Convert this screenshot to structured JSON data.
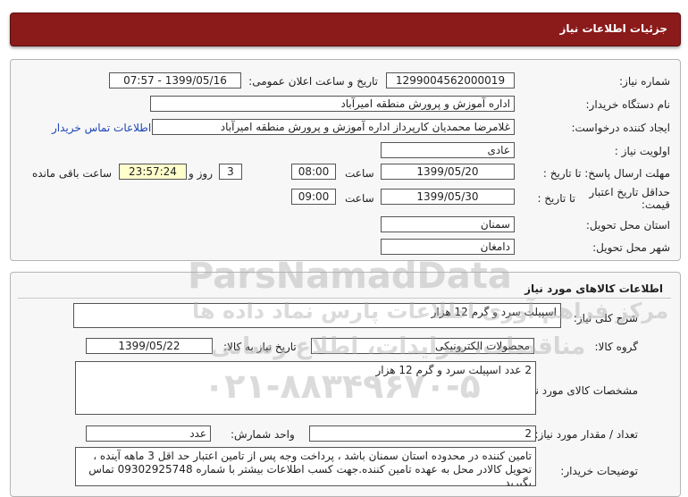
{
  "header": {
    "title": "جزئیات اطلاعات نیاز"
  },
  "watermark": {
    "brand": "ParsNamadData",
    "fa_line1": "مرکز فراهم آوری اطلاعات پارس نماد داده ها",
    "fa_line2": "مناقصات، مزایدات، اطلاع رسانی",
    "phone": "۰۲۱-۸۸۳۴۹۶۷۰-۵"
  },
  "info": {
    "need_number_label": "شماره نیاز:",
    "need_number": "1299004562000019",
    "announce_label": "تاریخ و ساعت اعلان عمومی:",
    "announce_value": "1399/05/16 - 07:57",
    "buyer_org_label": "نام دستگاه خریدار:",
    "buyer_org": "اداره آموزش و پرورش منطقه امیرآباد",
    "creator_label": "ایجاد کننده درخواست:",
    "creator": "غلامرضا محمدیان کارپرداز اداره آموزش و پرورش منطقه امیرآباد",
    "contact_link": "اطلاعات تماس خریدار",
    "priority_label": "اولویت نیاز :",
    "priority": "عادی",
    "deadline_label": "مهلت ارسال پاسخ: تا تاریخ :",
    "deadline_date": "1399/05/20",
    "time_label": "ساعت",
    "deadline_time": "08:00",
    "days_value": "3",
    "days_label": "روز و",
    "remaining_value": "23:57:24",
    "remaining_label": "ساعت باقی مانده",
    "validity_label_1": "حداقل تاریخ اعتبار",
    "validity_label_2": "قیمت:",
    "validity_until_label": "تا تاریخ :",
    "validity_date": "1399/05/30",
    "validity_time_label": "ساعت",
    "validity_time": "09:00",
    "province_label": "استان محل تحویل:",
    "province": "سمنان",
    "city_label": "شهر محل تحویل:",
    "city": "دامغان"
  },
  "goods": {
    "section_title": "اطلاعات کالاهای مورد نیاز",
    "summary_label": "شرح کلی نیاز:",
    "summary": "اسپیلت سرد و گرم 12 هزار",
    "group_label": "گروه کالا:",
    "group": "محصولات الکترونیکی",
    "need_date_label": "تاریخ نیاز به کالا:",
    "need_date": "1399/05/22",
    "spec_label": "مشخصات کالای مورد نیاز:",
    "spec": "2 عدد اسپیلت سرد و گرم 12 هزار",
    "qty_label": "تعداد / مقدار مورد نیاز:",
    "qty": "2",
    "unit_label": "واحد شمارش:",
    "unit": "عدد",
    "notes_label": "توضیحات خریدار:",
    "notes": "تامین کننده در محدوده استان سمنان باشد ، پرداخت وجه پس از تامین اعتبار حد اقل 3 ماهه آینده ، تحویل کالادر محل به عهده تامین کننده.جهت کسب اطلاعات بیشتر با شماره 09302925748 تماس بگیرید"
  }
}
